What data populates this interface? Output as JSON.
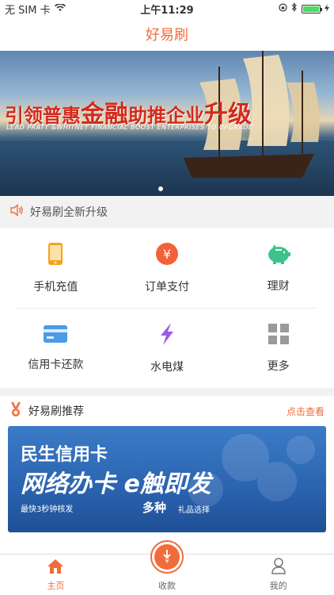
{
  "status": {
    "carrier": "无 SIM 卡",
    "time": "上午11:29"
  },
  "nav": {
    "title": "好易刷"
  },
  "banner": {
    "slogan_a": "引领普惠",
    "slogan_b": "金融",
    "slogan_c": "助推企业",
    "slogan_d": "升级",
    "subtitle": "LEAD PRATT &WHITNEY FINANCIAL BOOST ENTERPRISES TO UPGRADE"
  },
  "notice": {
    "text": "好易刷全新升级"
  },
  "grid": {
    "items": [
      {
        "label": "手机充值",
        "icon": "phone-icon"
      },
      {
        "label": "订单支付",
        "icon": "yuan-icon"
      },
      {
        "label": "理财",
        "icon": "piggy-bank-icon"
      },
      {
        "label": "信用卡还款",
        "icon": "credit-card-icon"
      },
      {
        "label": "水电煤",
        "icon": "lightning-icon"
      },
      {
        "label": "更多",
        "icon": "grid-icon"
      }
    ]
  },
  "recommend": {
    "title": "好易刷推荐",
    "more": "点击查看",
    "ad": {
      "line1": "民生信用卡",
      "line2": "网络办卡  e触即发",
      "line3": "最快3秒钟核发",
      "line4": "多种",
      "line5": "礼品选择"
    }
  },
  "tabbar": {
    "home": "主页",
    "collect": "收款",
    "mine": "我的"
  },
  "colors": {
    "accent": "#f26b3a"
  }
}
